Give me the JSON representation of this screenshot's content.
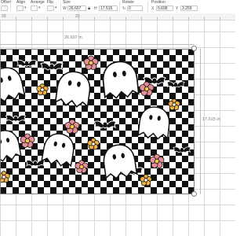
{
  "toolbar": {
    "offset_label": "Offset",
    "align_label": "Align",
    "arrange_label": "Arrange",
    "flip_label": "Flip",
    "size_label": "Size",
    "w_letter": "W",
    "width_value": "26.607",
    "h_letter": "H",
    "height_value": "17.515",
    "rotate_label": "Rotate",
    "rotate_value": "0",
    "position_label": "Position",
    "x_letter": "X",
    "x_value": "5.698",
    "y_letter": "Y",
    "y_value": "3.259"
  },
  "ruler": {
    "label_a": "20",
    "label_b": "20"
  },
  "canvas": {
    "width_dimension": "26.607 in",
    "height_dimension": "17.515 in"
  },
  "colors": {
    "pink_flower": "#e48f96",
    "orange_flower": "#f0b043",
    "flower_center": "#f5c84a",
    "ink": "#111111"
  }
}
